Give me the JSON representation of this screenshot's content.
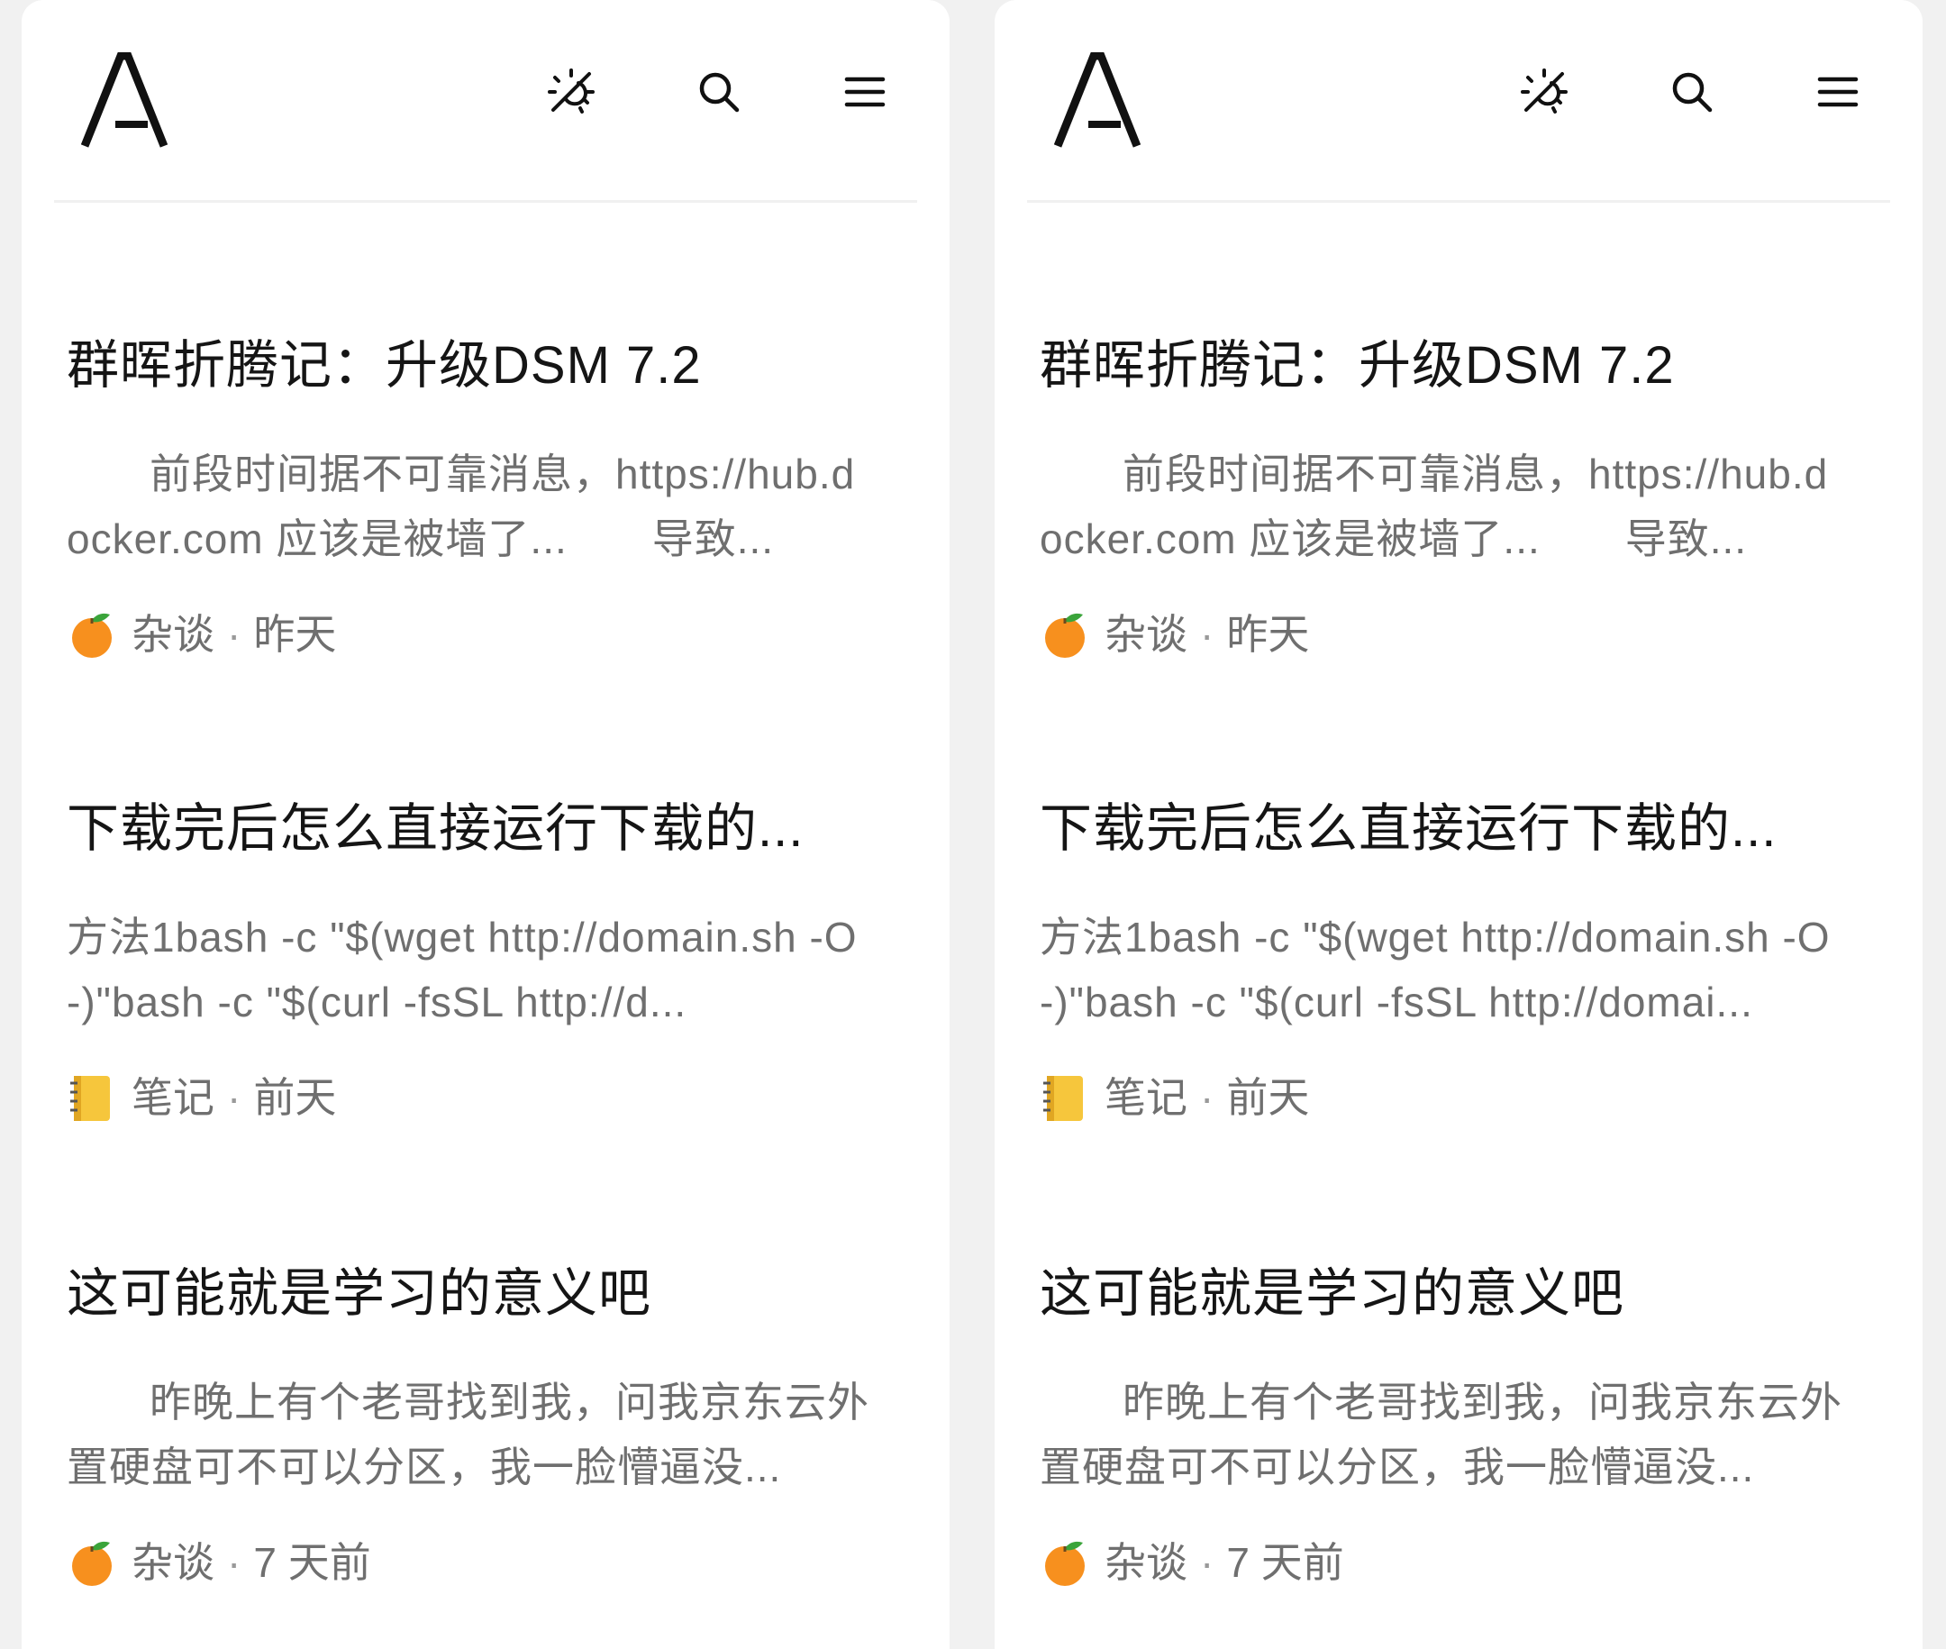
{
  "colors": {
    "background": "#f1f1f1",
    "panel": "#ffffff",
    "title": "#151515",
    "muted": "#6f6f6f"
  },
  "panels": [
    {
      "icons": [
        "theme-toggle-icon",
        "search-icon",
        "menu-icon"
      ],
      "posts": [
        {
          "title": "群晖折腾记：升级DSM 7.2",
          "excerpt": "前段时间据不可靠消息，https://hub.docker.com 应该是被墙了...　　导致...",
          "category_icon": "tangerine-emoji",
          "category": "杂谈",
          "separator": "·",
          "time": "昨天"
        },
        {
          "title": "下载完后怎么直接运行下载的...",
          "excerpt": "方法1bash -c \"$(wget http://domain.sh -O -)\"bash -c \"$(curl -fsSL http://d...",
          "category_icon": "notebook-emoji",
          "category": "笔记",
          "separator": "·",
          "time": "前天"
        },
        {
          "title": "这可能就是学习的意义吧",
          "excerpt": "昨晚上有个老哥找到我，问我京东云外置硬盘可不可以分区，我一脸懵逼没...",
          "category_icon": "tangerine-emoji",
          "category": "杂谈",
          "separator": "·",
          "time": "7 天前"
        }
      ]
    },
    {
      "icons": [
        "theme-toggle-icon",
        "search-icon",
        "menu-icon"
      ],
      "posts": [
        {
          "title": "群晖折腾记：升级DSM 7.2",
          "excerpt": "前段时间据不可靠消息，https://hub.docker.com 应该是被墙了...　　导致...",
          "category_icon": "tangerine-emoji",
          "category": "杂谈",
          "separator": "·",
          "time": "昨天"
        },
        {
          "title": "下载完后怎么直接运行下载的...",
          "excerpt": "方法1bash -c \"$(wget http://domain.sh -O -)\"bash -c \"$(curl -fsSL http://domai...",
          "category_icon": "notebook-emoji",
          "category": "笔记",
          "separator": "·",
          "time": "前天"
        },
        {
          "title": "这可能就是学习的意义吧",
          "excerpt": "昨晚上有个老哥找到我，问我京东云外置硬盘可不可以分区，我一脸懵逼没...",
          "category_icon": "tangerine-emoji",
          "category": "杂谈",
          "separator": "·",
          "time": "7 天前"
        }
      ]
    }
  ]
}
